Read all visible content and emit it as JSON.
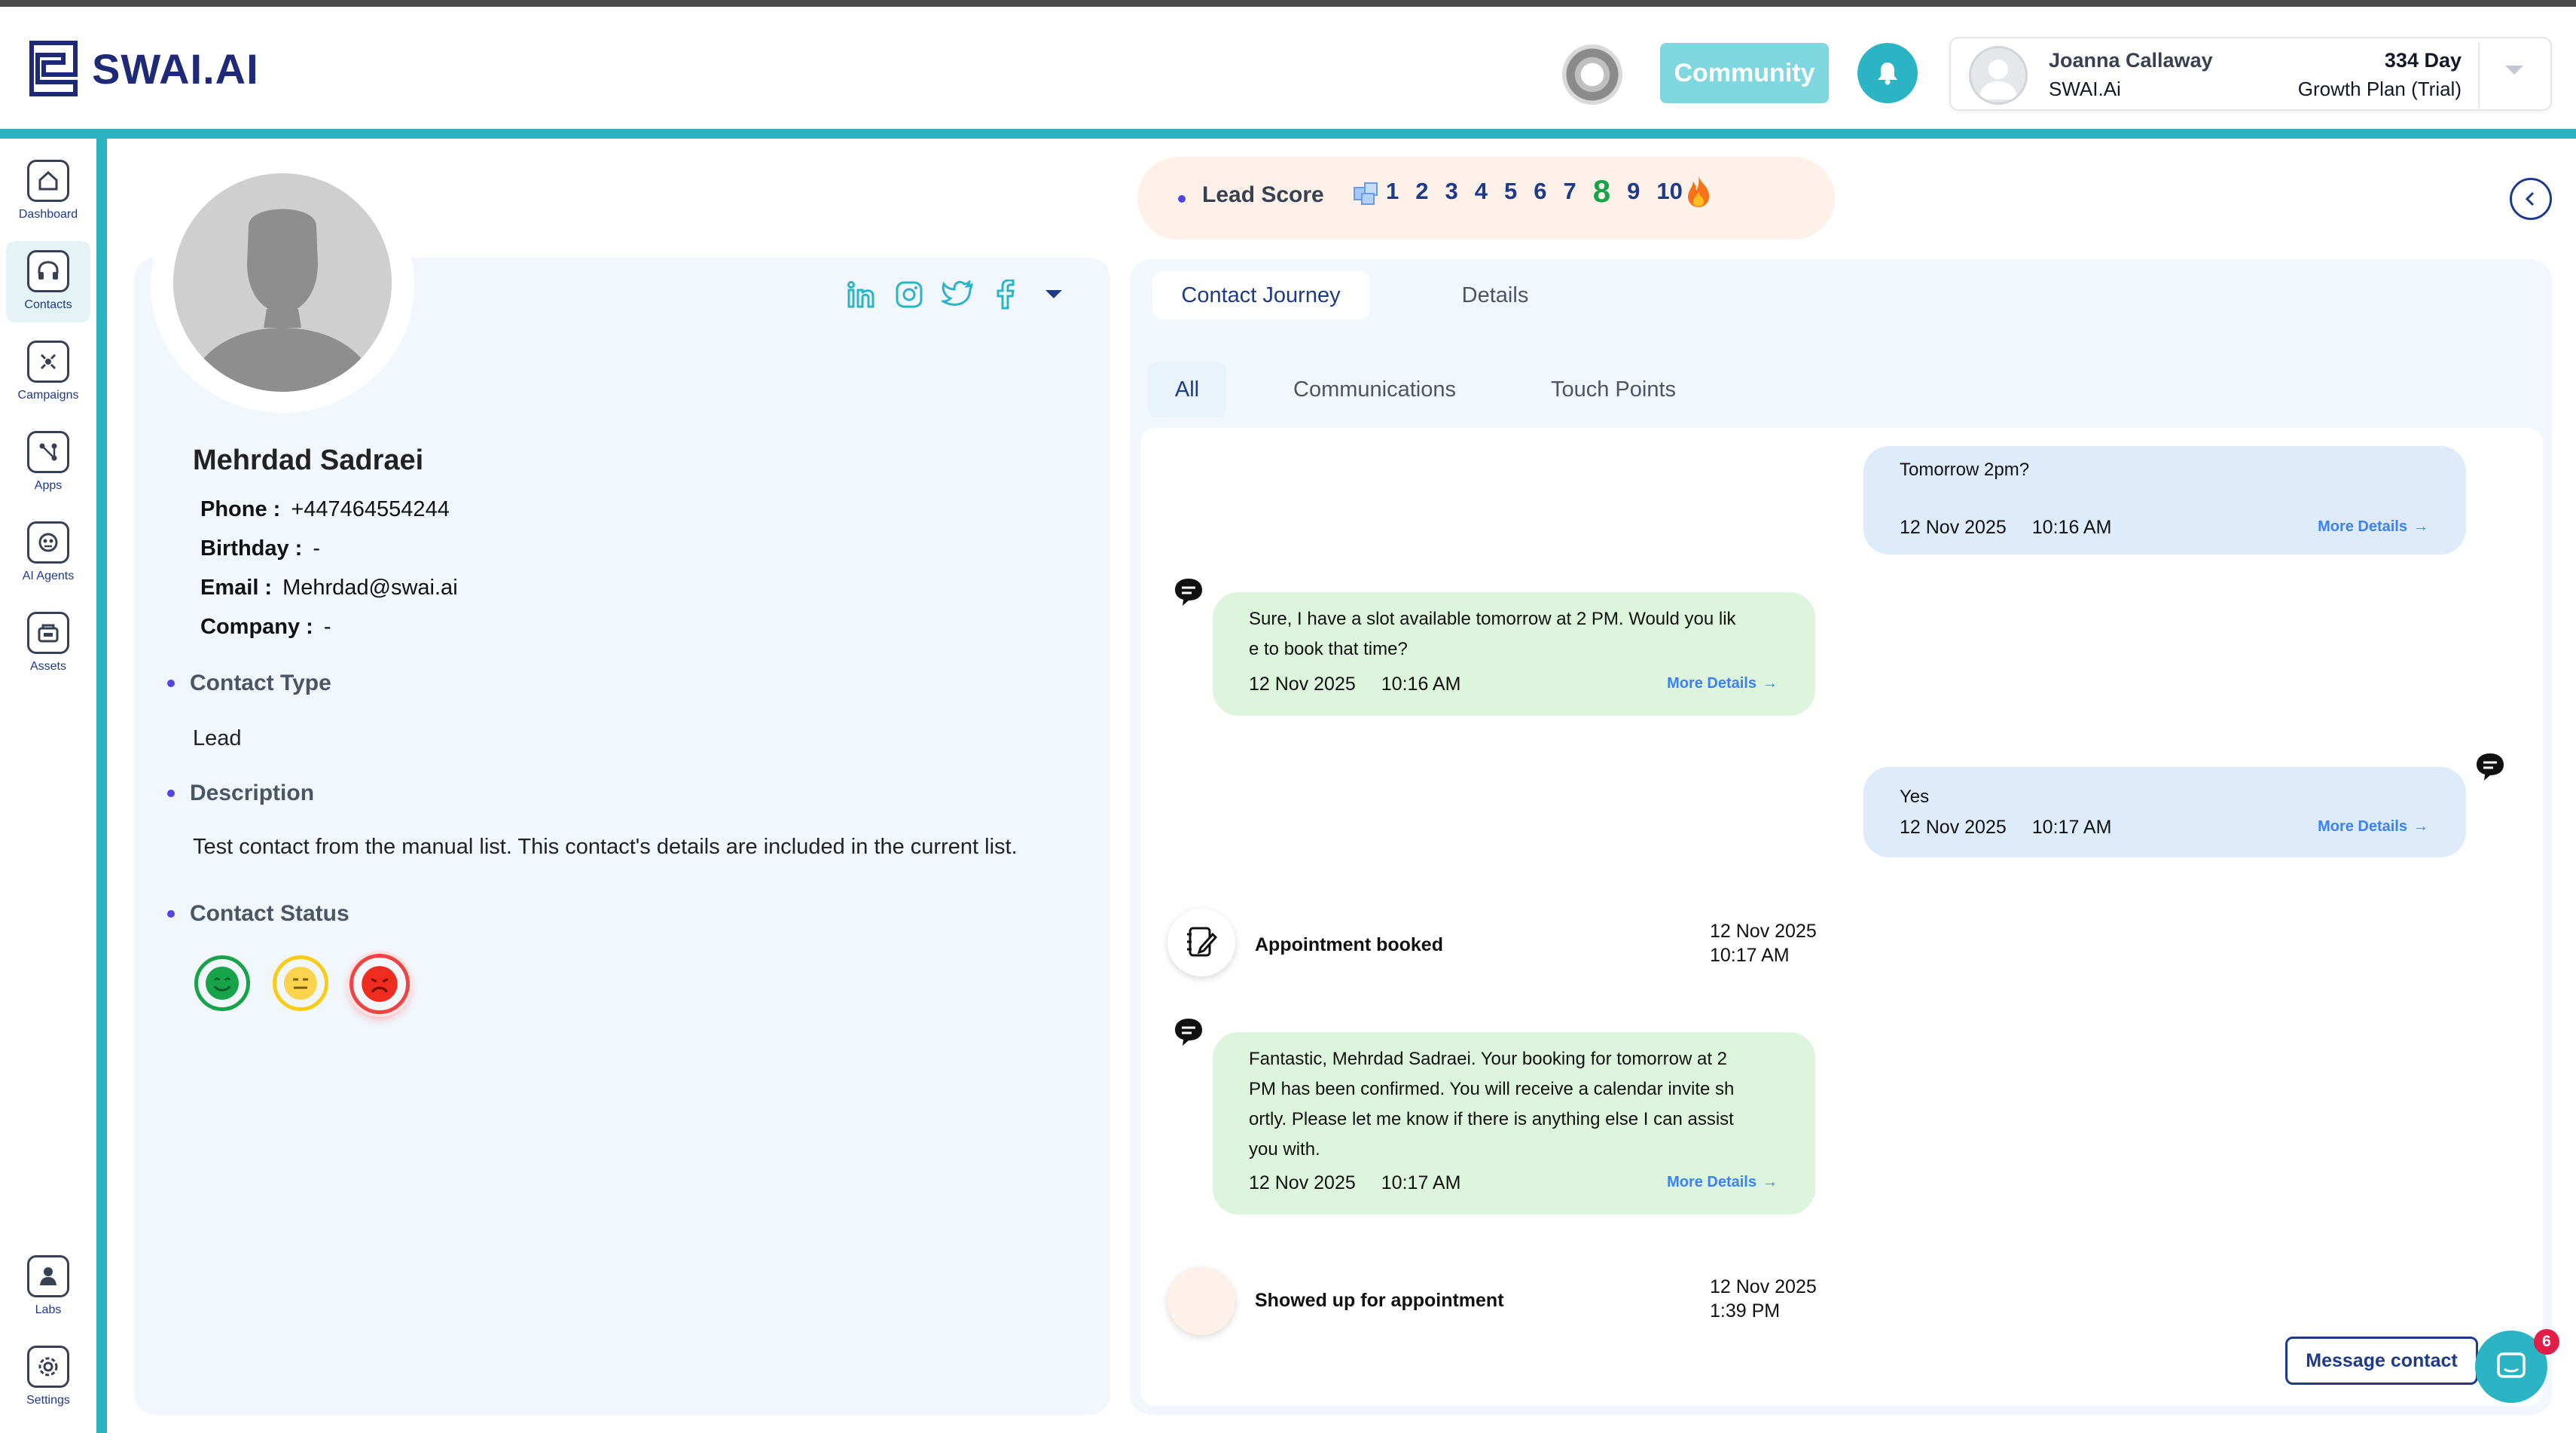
{
  "brand": {
    "name": "SWAI.AI"
  },
  "header": {
    "community_label": "Community",
    "user": {
      "name": "Joanna Callaway",
      "org": "SWAI.Ai",
      "days": "334 Day",
      "plan": "Growth Plan (Trial)"
    }
  },
  "sidebar": {
    "items": [
      {
        "label": "Dashboard",
        "icon": "home-icon"
      },
      {
        "label": "Contacts",
        "icon": "headset-icon",
        "active": true
      },
      {
        "label": "Campaigns",
        "icon": "campaign-icon"
      },
      {
        "label": "Apps",
        "icon": "flow-icon"
      },
      {
        "label": "AI Agents",
        "icon": "ai-agent-icon"
      },
      {
        "label": "Assets",
        "icon": "assets-icon"
      },
      {
        "label": "Labs",
        "icon": "labs-icon"
      },
      {
        "label": "Settings",
        "icon": "gear-icon"
      }
    ]
  },
  "lead_score": {
    "label": "Lead Score",
    "values": [
      "1",
      "2",
      "3",
      "4",
      "5",
      "6",
      "7",
      "8",
      "9",
      "10"
    ],
    "selected": "8"
  },
  "contact": {
    "name": "Mehrdad Sadraei",
    "phone_label": "Phone :",
    "phone": "+447464554244",
    "birthday_label": "Birthday :",
    "birthday": "-",
    "email_label": "Email :",
    "email": "Mehrdad@swai.ai",
    "company_label": "Company :",
    "company": "-",
    "type_heading": "Contact Type",
    "type": "Lead",
    "description_heading": "Description",
    "description": "Test contact from the manual list. This contact's details are included in the current list.",
    "status_heading": "Contact Status",
    "status_colors": {
      "happy": "#16a34a",
      "neutral": "#facc15",
      "sad": "#ef4444"
    }
  },
  "journey": {
    "tabs": [
      "Contact Journey",
      "Details"
    ],
    "sub_tabs": [
      "All",
      "Communications",
      "Touch Points"
    ],
    "more_details": "More Details",
    "items": [
      {
        "kind": "in",
        "text": [
          "Tomorrow 2pm?"
        ],
        "date": "12 Nov 2025",
        "time": "10:16 AM"
      },
      {
        "kind": "out",
        "text": [
          "Sure, I have a slot available tomorrow at 2 PM. Would you lik",
          "e to book that time?"
        ],
        "date": "12 Nov 2025",
        "time": "10:16 AM"
      },
      {
        "kind": "in",
        "text": [
          "Yes"
        ],
        "date": "12 Nov 2025",
        "time": "10:17 AM"
      },
      {
        "kind": "event",
        "label": "Appointment booked",
        "date": "12 Nov 2025",
        "time": "10:17 AM"
      },
      {
        "kind": "out",
        "text": [
          "Fantastic, Mehrdad Sadraei. Your booking for tomorrow at 2",
          "PM has been confirmed. You will receive a calendar invite sh",
          "ortly. Please let me know if there is anything else I can assist",
          "you with."
        ],
        "date": "12 Nov 2025",
        "time": "10:17 AM"
      },
      {
        "kind": "event",
        "label": "Showed up for appointment",
        "date": "12 Nov 2025",
        "time": "1:39 PM"
      }
    ]
  },
  "actions": {
    "message_contact": "Message contact",
    "chat_badge": "6"
  },
  "colors": {
    "teal": "#2bb5c4",
    "navy": "#1e3a8a",
    "panel": "#f1f7fd"
  }
}
